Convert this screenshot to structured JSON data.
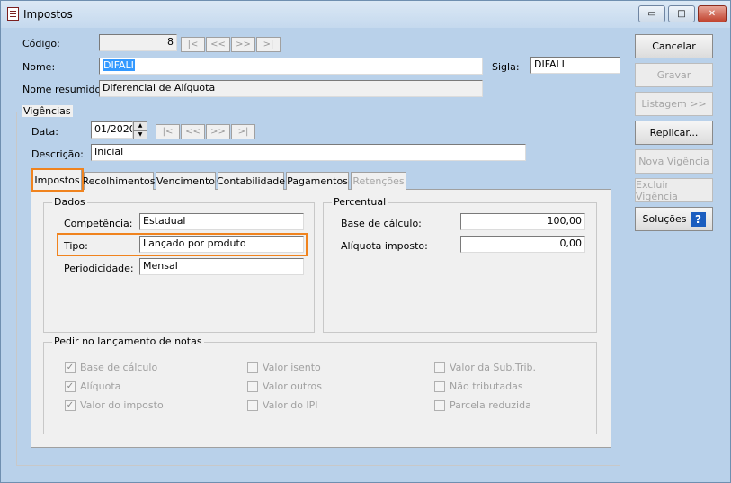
{
  "window": {
    "title": "Impostos",
    "min_symbol": "▭",
    "max_symbol": "□",
    "close_symbol": "✕"
  },
  "header": {
    "codigo_label": "Código:",
    "codigo_value": "8",
    "nav": [
      "|<",
      "<<",
      ">>",
      ">|"
    ],
    "nome_label": "Nome:",
    "nome_value": "DIFALI",
    "sigla_label": "Sigla:",
    "sigla_value": "DIFALI",
    "nome_resumido_label": "Nome resumido:",
    "nome_resumido_value": "Diferencial de Alíquota"
  },
  "buttons": {
    "cancelar": "Cancelar",
    "gravar": "Gravar",
    "listagem": "Listagem >>",
    "replicar": "Replicar...",
    "nova_vigencia": "Nova Vigência",
    "excluir_vigencia": "Excluir Vigência",
    "solucoes": "Soluções",
    "help_glyph": "?"
  },
  "vigencias": {
    "group_label": "Vigências",
    "data_label": "Data:",
    "data_value": "01/2020",
    "nav": [
      "|<",
      "<<",
      ">>",
      ">|"
    ],
    "descricao_label": "Descrição:",
    "descricao_value": "Inicial"
  },
  "tabs": [
    {
      "label": "Impostos",
      "active": true
    },
    {
      "label": "Recolhimentos",
      "active": false
    },
    {
      "label": "Vencimento",
      "active": false
    },
    {
      "label": "Contabilidade",
      "active": false
    },
    {
      "label": "Pagamentos",
      "active": false
    },
    {
      "label": "Retenções",
      "active": false,
      "disabled": true
    }
  ],
  "dados": {
    "group_label": "Dados",
    "competencia_label": "Competência:",
    "competencia_value": "Estadual",
    "tipo_label": "Tipo:",
    "tipo_value": "Lançado por produto",
    "periodicidade_label": "Periodicidade:",
    "periodicidade_value": "Mensal"
  },
  "percentual": {
    "group_label": "Percentual",
    "base_label": "Base de cálculo:",
    "base_value": "100,00",
    "aliquota_label": "Alíquota imposto:",
    "aliquota_value": "0,00"
  },
  "pedir": {
    "group_label": "Pedir no lançamento de notas",
    "checkmark": "✓",
    "items": [
      {
        "label": "Base de cálculo",
        "checked": true
      },
      {
        "label": "Alíquota",
        "checked": true
      },
      {
        "label": "Valor do imposto",
        "checked": true
      },
      {
        "label": "Valor isento",
        "checked": false
      },
      {
        "label": "Valor outros",
        "checked": false
      },
      {
        "label": "Valor do IPI",
        "checked": false
      },
      {
        "label": "Valor da Sub.Trib.",
        "checked": false
      },
      {
        "label": "Não tributadas",
        "checked": false
      },
      {
        "label": "Parcela reduzida",
        "checked": false
      }
    ]
  },
  "colors": {
    "highlight": "#f0831e",
    "selection": "#3399ff",
    "help_icon": "#1a5dbf"
  }
}
